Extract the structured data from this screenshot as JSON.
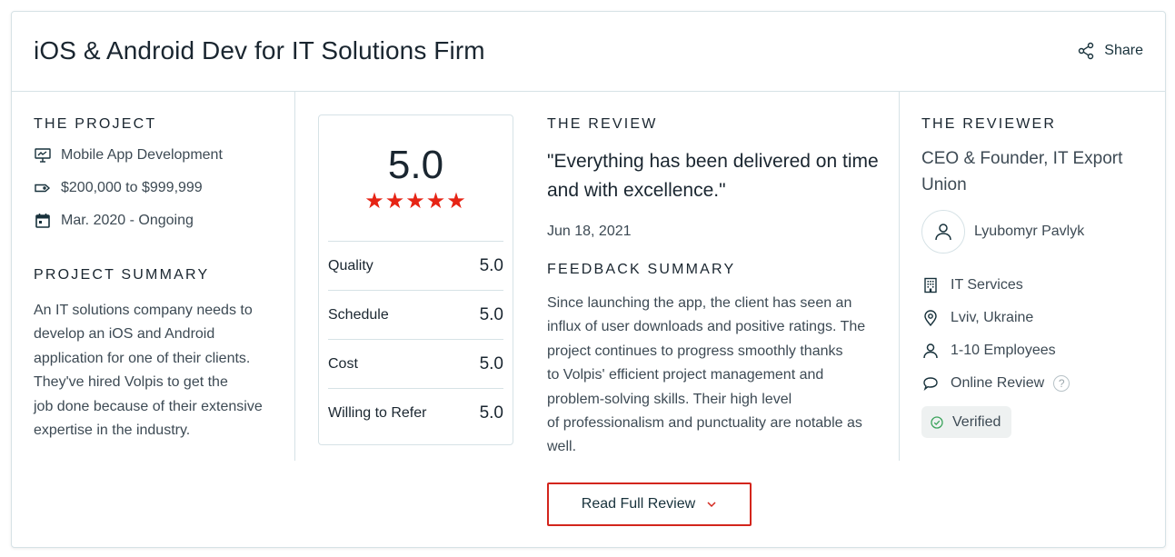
{
  "header": {
    "title": "iOS & Android Dev for IT Solutions Firm",
    "share_label": "Share"
  },
  "project": {
    "section_label": "THE PROJECT",
    "service": "Mobile App Development",
    "budget": "$200,000 to $999,999",
    "timeline": "Mar. 2020 - Ongoing",
    "summary_label": "PROJECT SUMMARY",
    "summary_lines": [
      "An IT solutions company needs to",
      "develop an iOS and Android",
      "application for one of their clients.",
      "They've hired Volpis to get the",
      "job done because of their extensive",
      "expertise in the industry."
    ]
  },
  "rating": {
    "overall": "5.0",
    "stars": "★★★★★",
    "stars_count": 5,
    "rows": [
      {
        "label": "Quality",
        "value": "5.0"
      },
      {
        "label": "Schedule",
        "value": "5.0"
      },
      {
        "label": "Cost",
        "value": "5.0"
      },
      {
        "label": "Willing to Refer",
        "value": "5.0"
      }
    ]
  },
  "review": {
    "section_label": "THE REVIEW",
    "quote_lines": [
      "\"Everything has been delivered on time",
      "and with excellence.\""
    ],
    "date": "Jun 18, 2021",
    "feedback_label": "FEEDBACK SUMMARY",
    "feedback_lines": [
      "Since launching the app, the client has seen an",
      "influx of user downloads and positive ratings. The",
      "project continues to progress smoothly thanks",
      "to Volpis' efficient project management and",
      "problem-solving skills. Their high level",
      "of professionalism and punctuality are notable as",
      "well."
    ],
    "read_full_label": "Read Full Review"
  },
  "reviewer": {
    "section_label": "THE REVIEWER",
    "role_lines": [
      "CEO & Founder, IT Export",
      "Union"
    ],
    "name": "Lyubomyr Pavlyk",
    "industry": "IT Services",
    "location": "Lviv, Ukraine",
    "size": "1-10 Employees",
    "review_type": "Online Review",
    "help_symbol": "?",
    "verified_label": "Verified"
  },
  "colors": {
    "accent_red": "#e62415",
    "button_border": "#d3251c",
    "icon_teal": "#17313b",
    "divider": "#d6e2e6",
    "verified_green": "#3aa35b"
  }
}
